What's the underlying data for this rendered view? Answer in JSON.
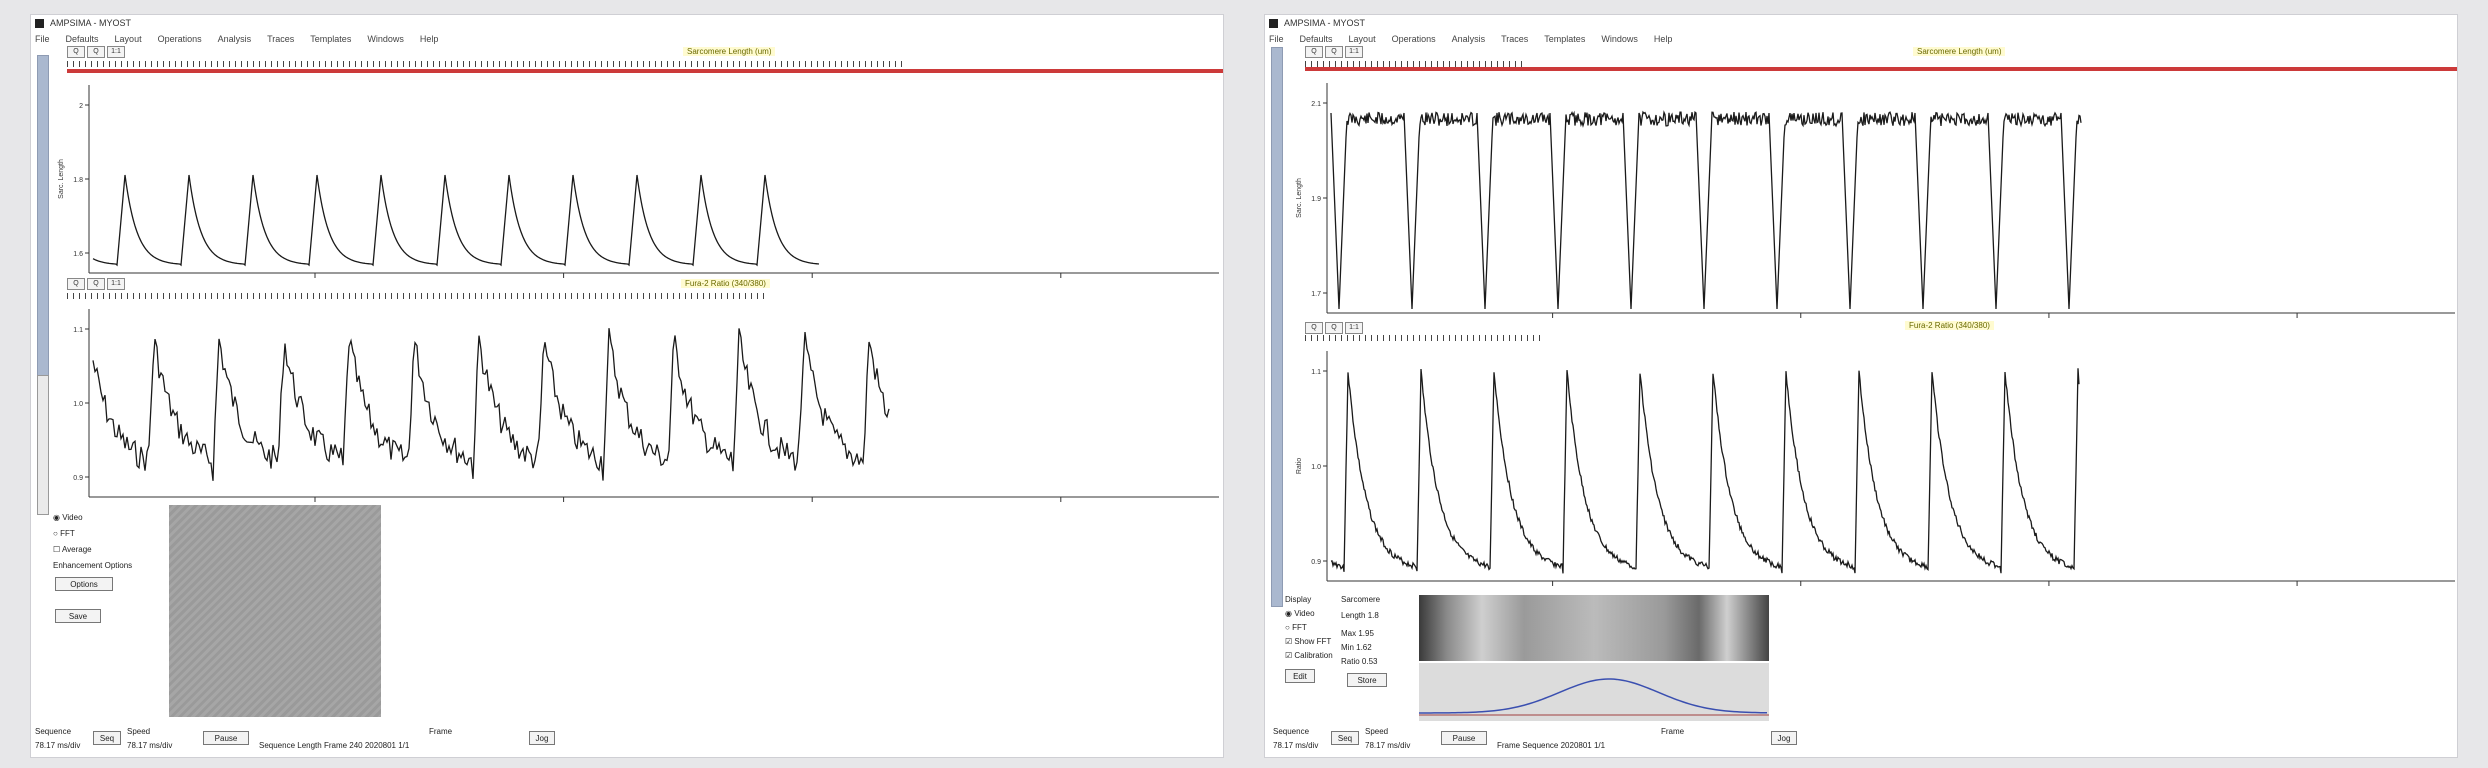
{
  "left_window": {
    "title": "AMPSIMA - MYOST",
    "menu": [
      "File",
      "Defaults",
      "Layout",
      "Operations",
      "Analysis",
      "Traces",
      "Templates",
      "Windows",
      "Help"
    ],
    "toolbar_buttons": [
      "Q",
      "Q",
      "1:1"
    ],
    "trace1": {
      "title": "Sarcomere Length (um)",
      "ylabel": "Sarc. Length",
      "yticks": [
        "2",
        "1.8",
        "1.6"
      ]
    },
    "trace2": {
      "title": "Fura-2 Ratio (340/380)",
      "yticks": [
        "1.1",
        "1.0",
        "0.9"
      ]
    },
    "controls": {
      "radio_video": "Video",
      "radio_fft": "FFT",
      "checkbox_average": "Average",
      "label_enhancement": "Enhancement Options",
      "btn_options": "Options",
      "btn_save": "Save"
    },
    "status": {
      "sequence_label": "Sequence",
      "sequence_value": "78.17 ms/div",
      "btn_seq": "Seq",
      "speed_label": "Speed",
      "speed_value": "78.17 ms/div",
      "btn_pause": "Pause",
      "status_text": "Sequence Length Frame 240  2020801 1/1",
      "frame_label": "Frame",
      "btn_jog": "Jog"
    },
    "accent_color": "#cc3a3a"
  },
  "right_window": {
    "title": "AMPSIMA - MYOST",
    "menu": [
      "File",
      "Defaults",
      "Layout",
      "Operations",
      "Analysis",
      "Traces",
      "Templates",
      "Windows",
      "Help"
    ],
    "toolbar_buttons": [
      "Q",
      "Q",
      "1:1"
    ],
    "trace1": {
      "title": "Sarcomere Length (um)",
      "ylabel": "Sarc. Length",
      "yticks": [
        "2.1",
        "1.9",
        "1.7"
      ]
    },
    "trace2": {
      "title": "Fura-2 Ratio (340/380)",
      "ylabel": "Ratio",
      "yticks": [
        "1.1",
        "1.0",
        "0.9"
      ]
    },
    "controls": {
      "label_display": "Display",
      "radio_video": "Video",
      "radio_fft": "FFT",
      "checkbox_show_fft": "Show FFT",
      "checkbox_calibration": "Calibration",
      "btn_edit": "Edit",
      "label_sarcomere": "Sarcomere",
      "field_length_label": "Length",
      "field_length_value": "1.8",
      "field_max_label": "Max",
      "field_max_value": "1.95",
      "field_min_label": "Min",
      "field_min_value": "1.62",
      "field_ratio_label": "Ratio",
      "field_ratio_value": "0.53",
      "btn_store": "Store"
    },
    "status": {
      "sequence_label": "Sequence",
      "sequence_value": "78.17 ms/div",
      "btn_seq": "Seq",
      "speed_label": "Speed",
      "speed_value": "78.17 ms/div",
      "btn_pause": "Pause",
      "status_text": "Frame Sequence 2020801 1/1",
      "frame_label": "Frame",
      "btn_jog": "Jog"
    },
    "accent_color": "#cc3a3a"
  }
}
